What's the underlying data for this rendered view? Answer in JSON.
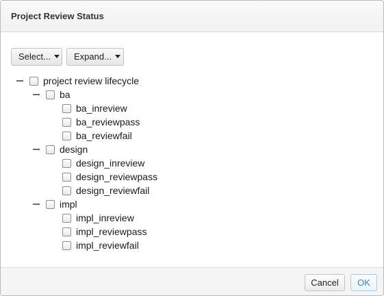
{
  "dialog": {
    "title": "Project Review Status"
  },
  "toolbar": {
    "select_label": "Select...",
    "expand_label": "Expand..."
  },
  "tree": {
    "root": {
      "label": "project review lifecycle",
      "checked": false,
      "expanded": true
    },
    "groups": [
      {
        "label": "ba",
        "checked": false,
        "expanded": true,
        "children": [
          "ba_inreview",
          "ba_reviewpass",
          "ba_reviewfail"
        ]
      },
      {
        "label": "design",
        "checked": false,
        "expanded": true,
        "children": [
          "design_inreview",
          "design_reviewpass",
          "design_reviewfail"
        ]
      },
      {
        "label": "impl",
        "checked": false,
        "expanded": true,
        "children": [
          "impl_inreview",
          "impl_reviewpass",
          "impl_reviewfail"
        ]
      }
    ]
  },
  "footer": {
    "cancel_label": "Cancel",
    "ok_label": "OK"
  },
  "colors": {
    "ok_text": "#2f86d2",
    "header_bg": "#f3f3f3",
    "footer_bg": "#f5f5f5"
  }
}
